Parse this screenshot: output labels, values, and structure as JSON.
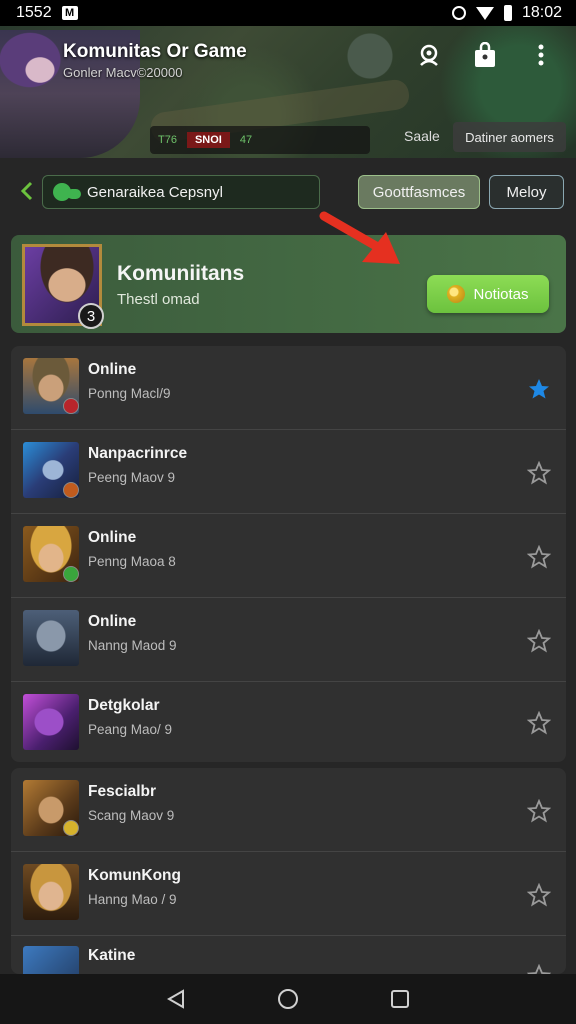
{
  "status_bar": {
    "time_left": "1552",
    "time_right": "18:02"
  },
  "header": {
    "title": "Komunitas Or Game",
    "subtitle": "Gonler Macv©20000",
    "hud_left": "T76",
    "hud_center": "SNOI",
    "hud_right": "47",
    "scale_label": "Saale",
    "danger_label": "Datiner aomers"
  },
  "toolbar": {
    "search_value": "Genaraikea Cepsnyl",
    "tab_active": "Goottfasmces",
    "tab_other": "Meloy"
  },
  "banner": {
    "title": "Komuniitans",
    "subtitle": "Thestl omad",
    "badge": "3",
    "notify_label": "Notiotas"
  },
  "list": [
    {
      "name": "Online",
      "sub": "Ponng Macl/9",
      "starred": true
    },
    {
      "name": "Nanpacrinrce",
      "sub": "Peeng Maov 9",
      "starred": false
    },
    {
      "name": "Online",
      "sub": "Penng Maoa 8",
      "starred": false
    },
    {
      "name": "Online",
      "sub": "Nanng Maod 9",
      "starred": false
    },
    {
      "name": "Detgkolar",
      "sub": "Peang Mao/ 9",
      "starred": false
    },
    {
      "name": "Fescialbr",
      "sub": "Scang Maov 9",
      "starred": false
    },
    {
      "name": "KomunKong",
      "sub": "Hanng Mao / 9",
      "starred": false
    },
    {
      "name": "Katine",
      "sub": "",
      "starred": false
    }
  ],
  "colors": {
    "accent_green": "#6cc23e",
    "star_blue": "#1e88e5"
  }
}
